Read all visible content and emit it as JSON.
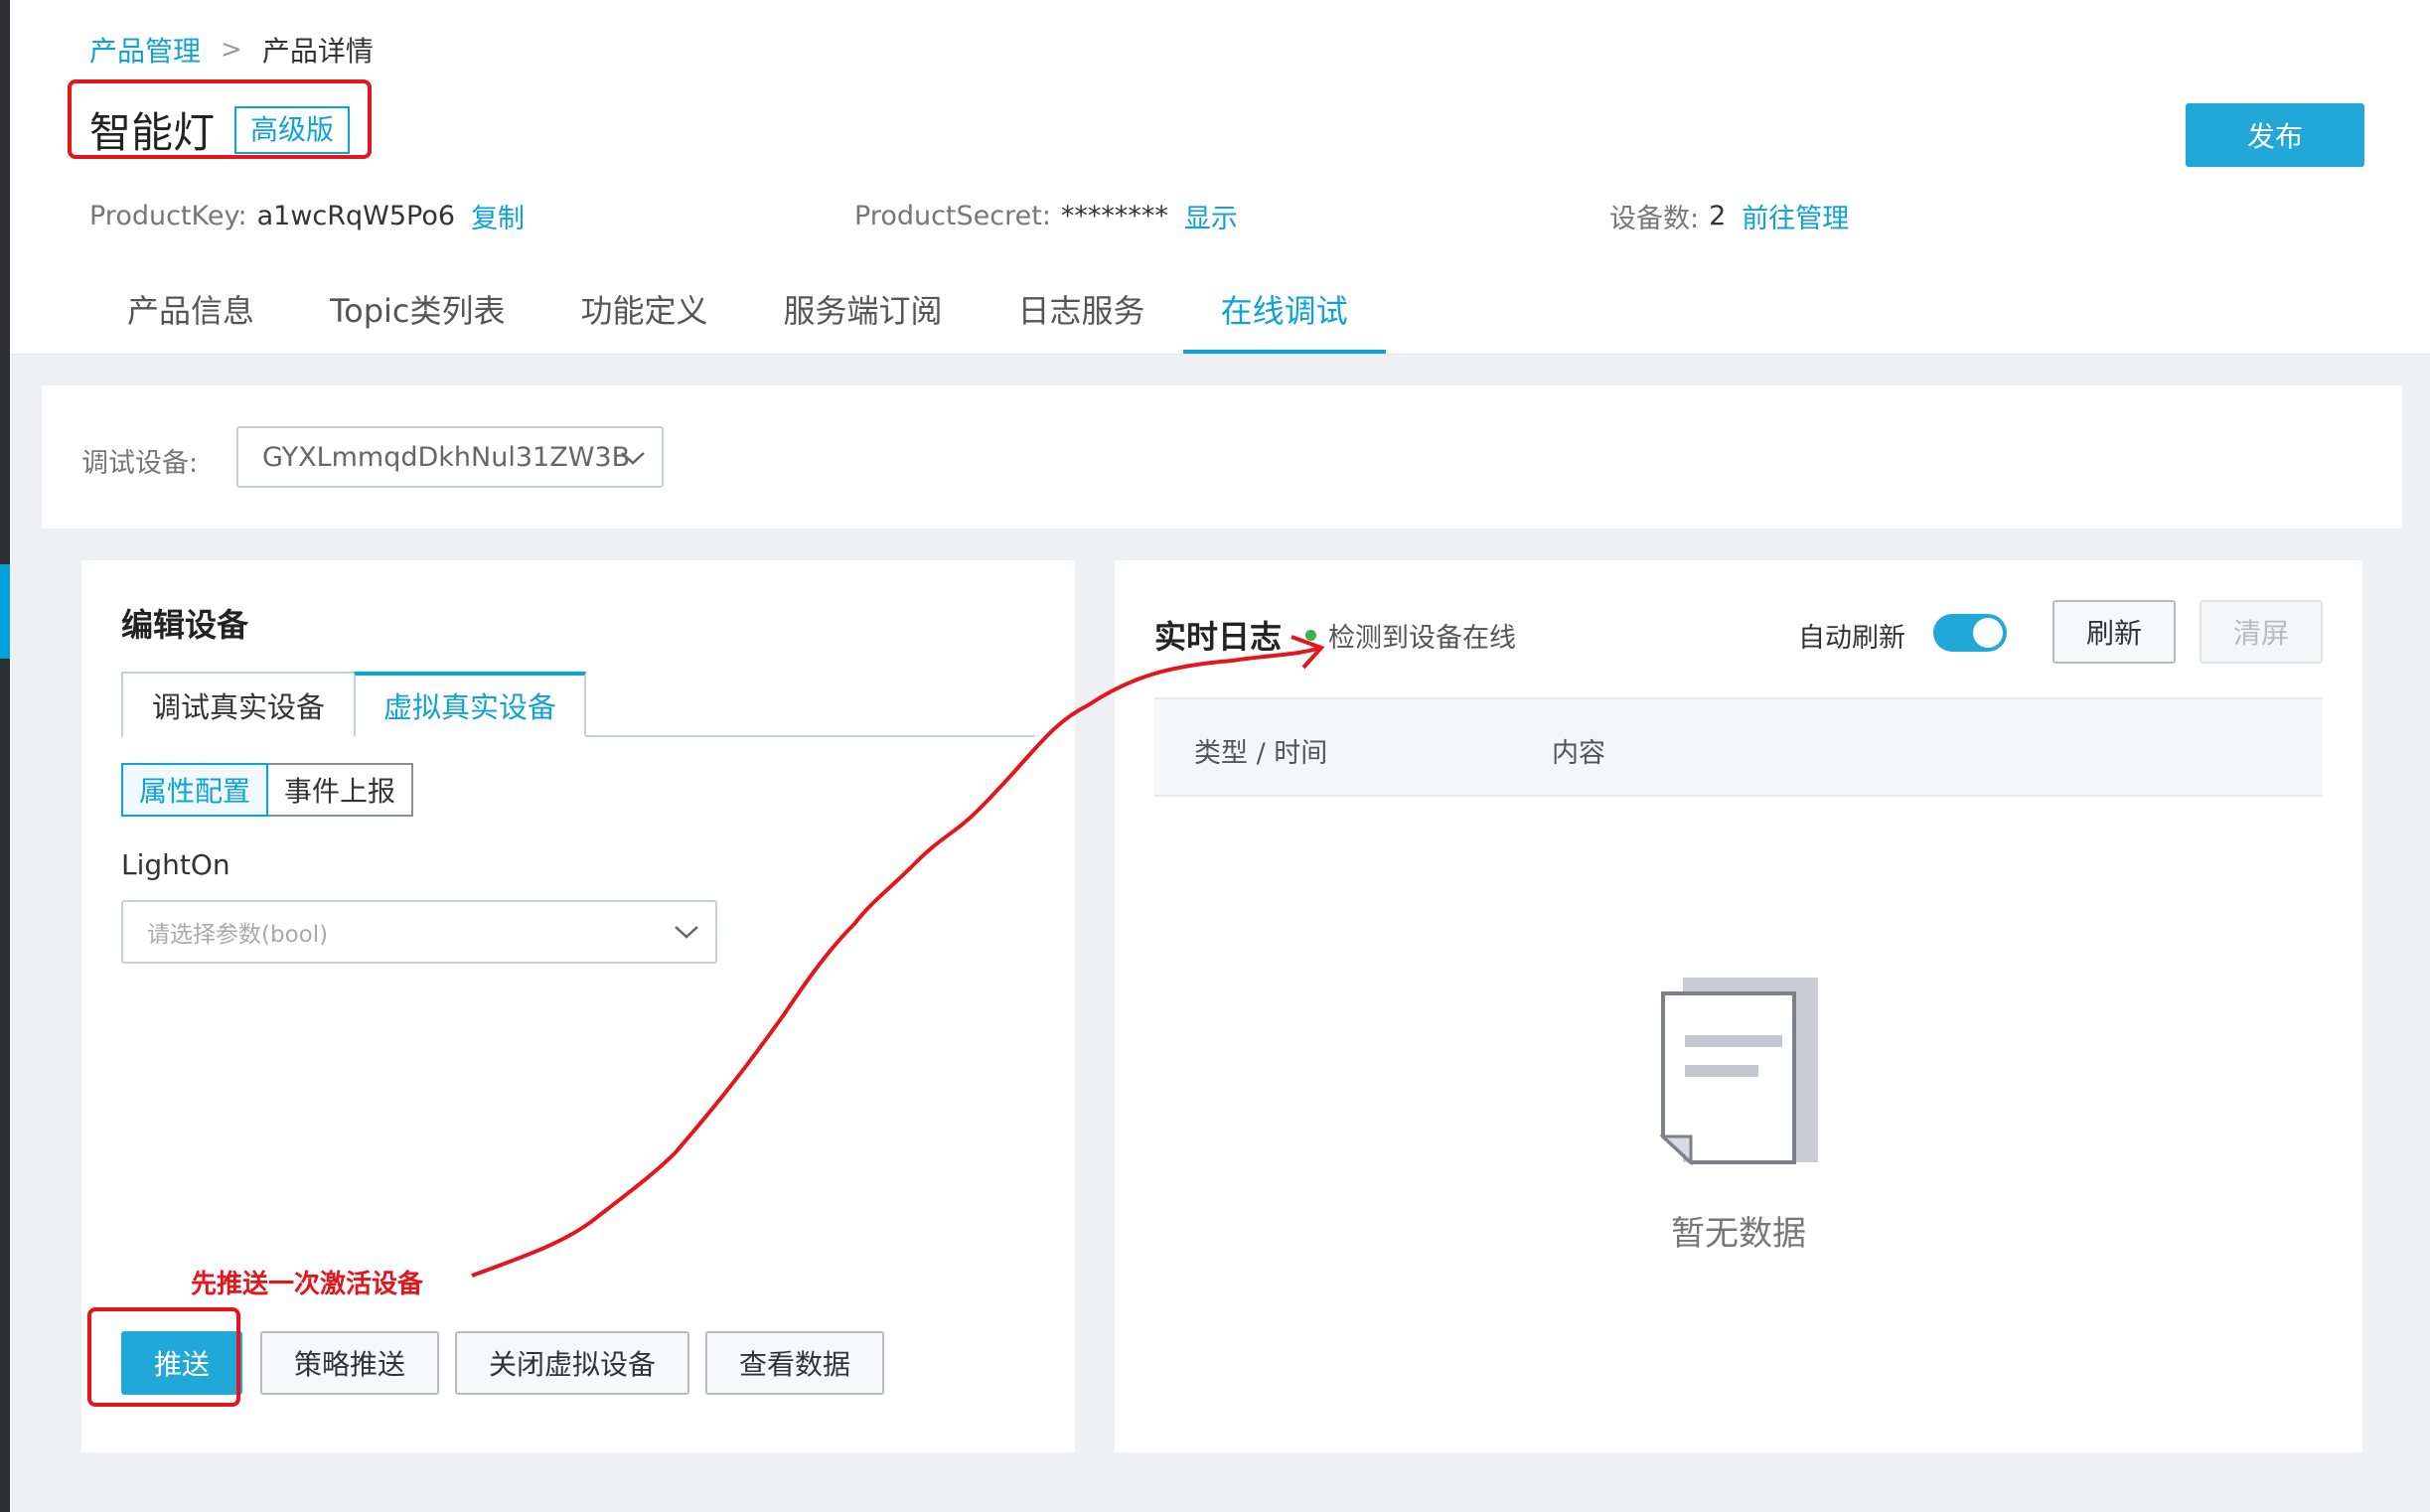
{
  "breadcrumb": {
    "parent": "产品管理",
    "separator": ">",
    "current": "产品详情"
  },
  "product": {
    "name": "智能灯",
    "edition": "高级版",
    "publish_label": "发布",
    "product_key_label": "ProductKey:",
    "product_key": "a1wcRqW5Po6",
    "copy_label": "复制",
    "product_secret_label": "ProductSecret:",
    "product_secret": "********",
    "show_label": "显示",
    "device_count_label": "设备数:",
    "device_count": "2",
    "manage_label": "前往管理"
  },
  "tabs": [
    {
      "label": "产品信息",
      "active": false
    },
    {
      "label": "Topic类列表",
      "active": false
    },
    {
      "label": "功能定义",
      "active": false
    },
    {
      "label": "服务端订阅",
      "active": false
    },
    {
      "label": "日志服务",
      "active": false
    },
    {
      "label": "在线调试",
      "active": true
    }
  ],
  "debug_device": {
    "label": "调试设备:",
    "selected": "GYXLmmqdDkhNul31ZW3B"
  },
  "edit_panel": {
    "title": "编辑设备",
    "mode_tabs": [
      "调试真实设备",
      "虚拟真实设备"
    ],
    "active_mode": 1,
    "segments": [
      "属性配置",
      "事件上报"
    ],
    "active_segment": 0,
    "field_label": "LightOn",
    "field_placeholder": "请选择参数(bool)",
    "buttons": {
      "push": "推送",
      "strategy_push": "策略推送",
      "close_virtual": "关闭虚拟设备",
      "view_data": "查看数据"
    }
  },
  "annotation": "先推送一次激活设备",
  "log_panel": {
    "title": "实时日志",
    "online_status": "检测到设备在线",
    "auto_refresh_label": "自动刷新",
    "auto_refresh_on": true,
    "refresh_label": "刷新",
    "clear_label": "清屏",
    "columns": [
      "类型 / 时间",
      "内容"
    ],
    "empty_text": "暂无数据"
  },
  "colors": {
    "accent": "#0fa2d6",
    "primary_button": "#22a8d8",
    "annotation_red": "#e5151b",
    "online_green": "#36b34a"
  }
}
